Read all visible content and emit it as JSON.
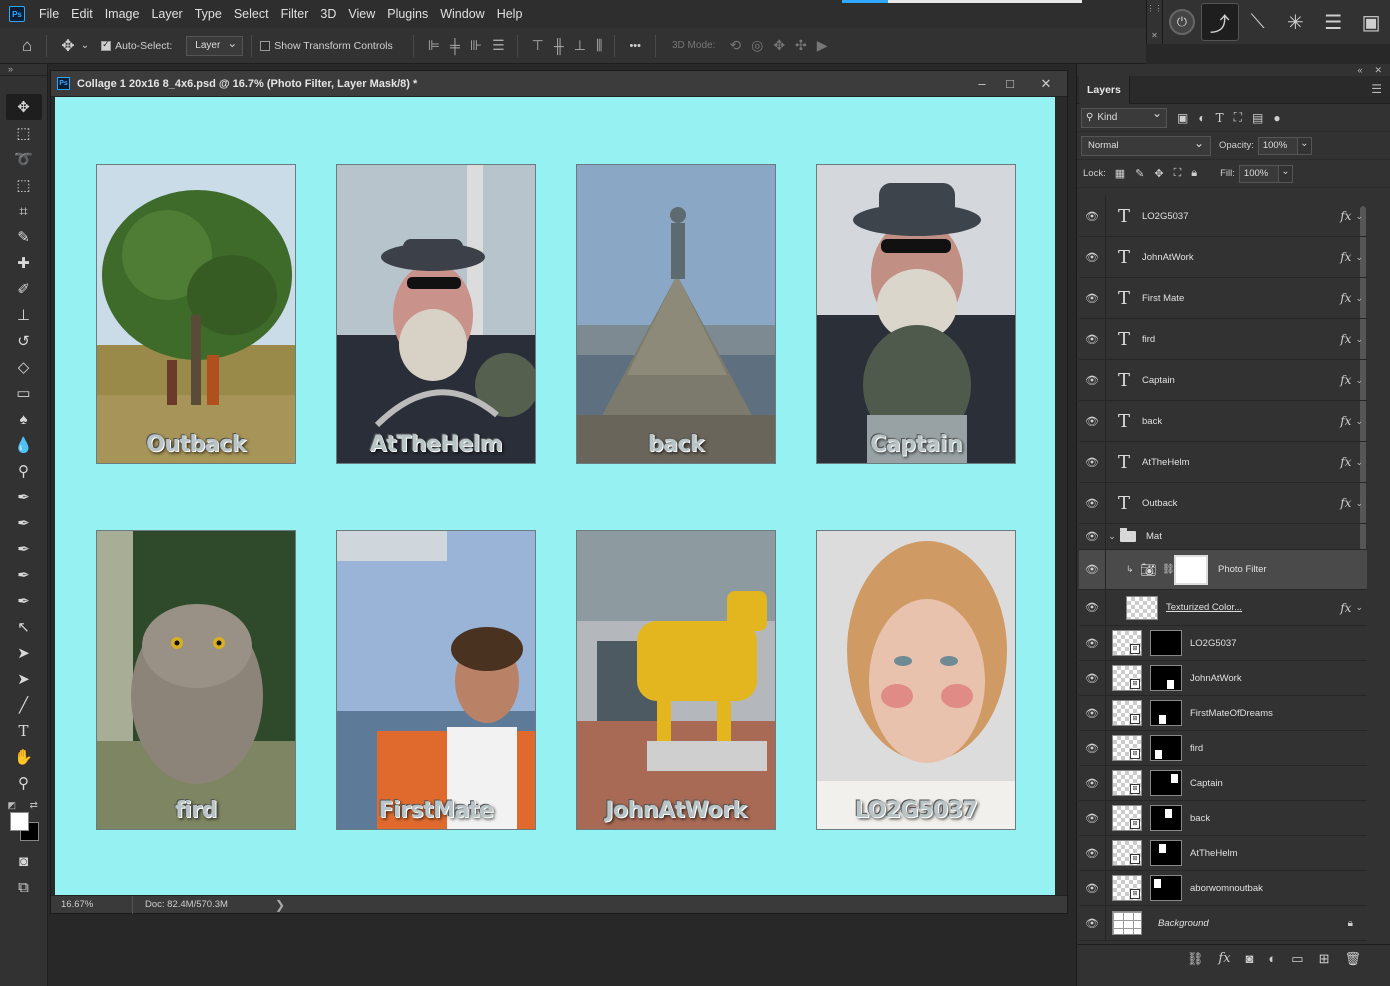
{
  "app": {
    "logo": "Ps",
    "menu": [
      "File",
      "Edit",
      "Image",
      "Layer",
      "Type",
      "Select",
      "Filter",
      "3D",
      "View",
      "Plugins",
      "Window",
      "Help"
    ]
  },
  "options_bar": {
    "auto_select_label": "Auto-Select:",
    "auto_select_checked": true,
    "auto_select_target": "Layer",
    "transform_controls_label": "Show Transform Controls",
    "transform_controls_checked": false,
    "more_label": "•••",
    "threed_mode_label": "3D Mode:"
  },
  "document": {
    "tab_title": "Collage 1 20x16 8_4x6.psd @ 16.7% (Photo Filter, Layer Mask/8) *",
    "background_color": "#96f1f2",
    "photos": [
      {
        "caption": "Outback",
        "subject": "tree-landscape"
      },
      {
        "caption": "AtTheHelm",
        "subject": "sailor-at-wheel"
      },
      {
        "caption": "back",
        "subject": "statue-on-cairn"
      },
      {
        "caption": "Captain",
        "subject": "captain-portrait"
      },
      {
        "caption": "fird",
        "subject": "owl"
      },
      {
        "caption": "FirstMate",
        "subject": "smiling-woman"
      },
      {
        "caption": "JohnAtWork",
        "subject": "painted-cow-statue"
      },
      {
        "caption": "LO2G5037",
        "subject": "girl-portrait"
      }
    ],
    "status": {
      "zoom": "16.67%",
      "doc_info": "Doc: 82.4M/570.3M",
      "arrow": "❯"
    }
  },
  "layers_panel": {
    "tab": "Layers",
    "filter_kind": "Kind",
    "blend_mode": "Normal",
    "opacity_label": "Opacity:",
    "opacity": "100%",
    "lock_label": "Lock:",
    "fill_label": "Fill:",
    "fill": "100%",
    "text_layers": [
      "LO2G5037",
      "JohnAtWork",
      "First Mate",
      "fird",
      "Captain",
      "back",
      "AtTheHelm",
      "Outback"
    ],
    "group": {
      "name": "Mat"
    },
    "adjustment_layer": {
      "name": "Photo Filter"
    },
    "texture_layer": {
      "name": "Texturized Color..."
    },
    "image_layers": [
      "LO2G5037",
      "JohnAtWork",
      "FirstMateOfDreams",
      "fird",
      "Captain",
      "back",
      "AtTheHelm",
      "aborwomnoutbak"
    ],
    "background_layer": {
      "name": "Background"
    }
  }
}
